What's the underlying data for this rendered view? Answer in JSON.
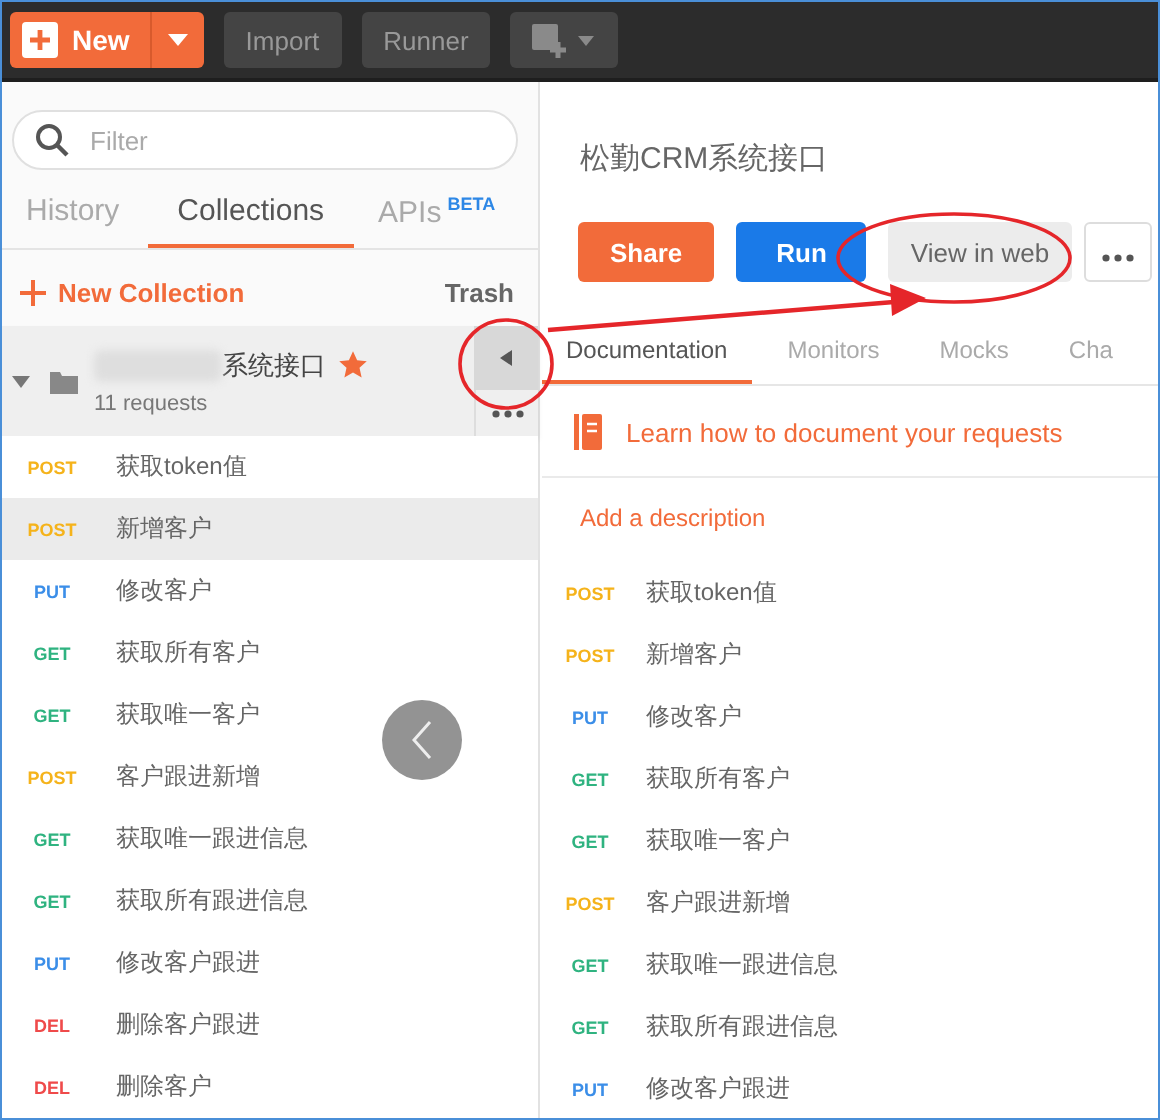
{
  "toolbar": {
    "new_button": "New",
    "import_button": "Import",
    "runner_button": "Runner"
  },
  "sidebar": {
    "filter": {
      "placeholder": "Filter"
    },
    "tabs": [
      {
        "label": "History",
        "selected": false
      },
      {
        "label": "Collections",
        "selected": true
      },
      {
        "label": "APIs",
        "badge": "BETA",
        "selected": false
      }
    ],
    "new_collection": "New Collection",
    "trash": "Trash",
    "collection": {
      "name": "系统接口",
      "starred": true,
      "count": "11 requests"
    },
    "requests": [
      {
        "method": "POST",
        "name": "获取token值",
        "color": "#f5b31b",
        "selected": false
      },
      {
        "method": "POST",
        "name": "新增客户",
        "color": "#f5b31b",
        "selected": true
      },
      {
        "method": "PUT",
        "name": "修改客户",
        "color": "#3b8ee8",
        "selected": false
      },
      {
        "method": "GET",
        "name": "获取所有客户",
        "color": "#2fb380",
        "selected": false
      },
      {
        "method": "GET",
        "name": "获取唯一客户",
        "color": "#2fb380",
        "selected": false
      },
      {
        "method": "POST",
        "name": "客户跟进新增",
        "color": "#f5b31b",
        "selected": false
      },
      {
        "method": "GET",
        "name": "获取唯一跟进信息",
        "color": "#2fb380",
        "selected": false
      },
      {
        "method": "GET",
        "name": "获取所有跟进信息",
        "color": "#2fb380",
        "selected": false
      },
      {
        "method": "PUT",
        "name": "修改客户跟进",
        "color": "#3b8ee8",
        "selected": false
      },
      {
        "method": "DEL",
        "name": "删除客户跟进",
        "color": "#ef4a4a",
        "selected": false
      },
      {
        "method": "DEL",
        "name": "删除客户",
        "color": "#ef4a4a",
        "selected": false
      }
    ]
  },
  "main": {
    "title": "松勤CRM系统接口",
    "buttons": [
      {
        "label": "Share",
        "kind": "accent"
      },
      {
        "label": "Run",
        "kind": "primary"
      },
      {
        "label": "View in web",
        "kind": "secondary"
      }
    ],
    "tabs": [
      {
        "label": "Documentation",
        "selected": true
      },
      {
        "label": "Monitors",
        "selected": false
      },
      {
        "label": "Mocks",
        "selected": false
      },
      {
        "label": "Cha",
        "selected": false
      }
    ],
    "learn_link": "Learn how to document your requests",
    "add_description": "Add a description",
    "requests": [
      {
        "method": "POST",
        "name": "获取token值",
        "color": "#f5b31b"
      },
      {
        "method": "POST",
        "name": "新增客户",
        "color": "#f5b31b"
      },
      {
        "method": "PUT",
        "name": "修改客户",
        "color": "#3b8ee8"
      },
      {
        "method": "GET",
        "name": "获取所有客户",
        "color": "#2fb380"
      },
      {
        "method": "GET",
        "name": "获取唯一客户",
        "color": "#2fb380"
      },
      {
        "method": "POST",
        "name": "客户跟进新增",
        "color": "#f5b31b"
      },
      {
        "method": "GET",
        "name": "获取唯一跟进信息",
        "color": "#2fb380"
      },
      {
        "method": "GET",
        "name": "获取所有跟进信息",
        "color": "#2fb380"
      },
      {
        "method": "PUT",
        "name": "修改客户跟进",
        "color": "#3b8ee8"
      }
    ]
  }
}
